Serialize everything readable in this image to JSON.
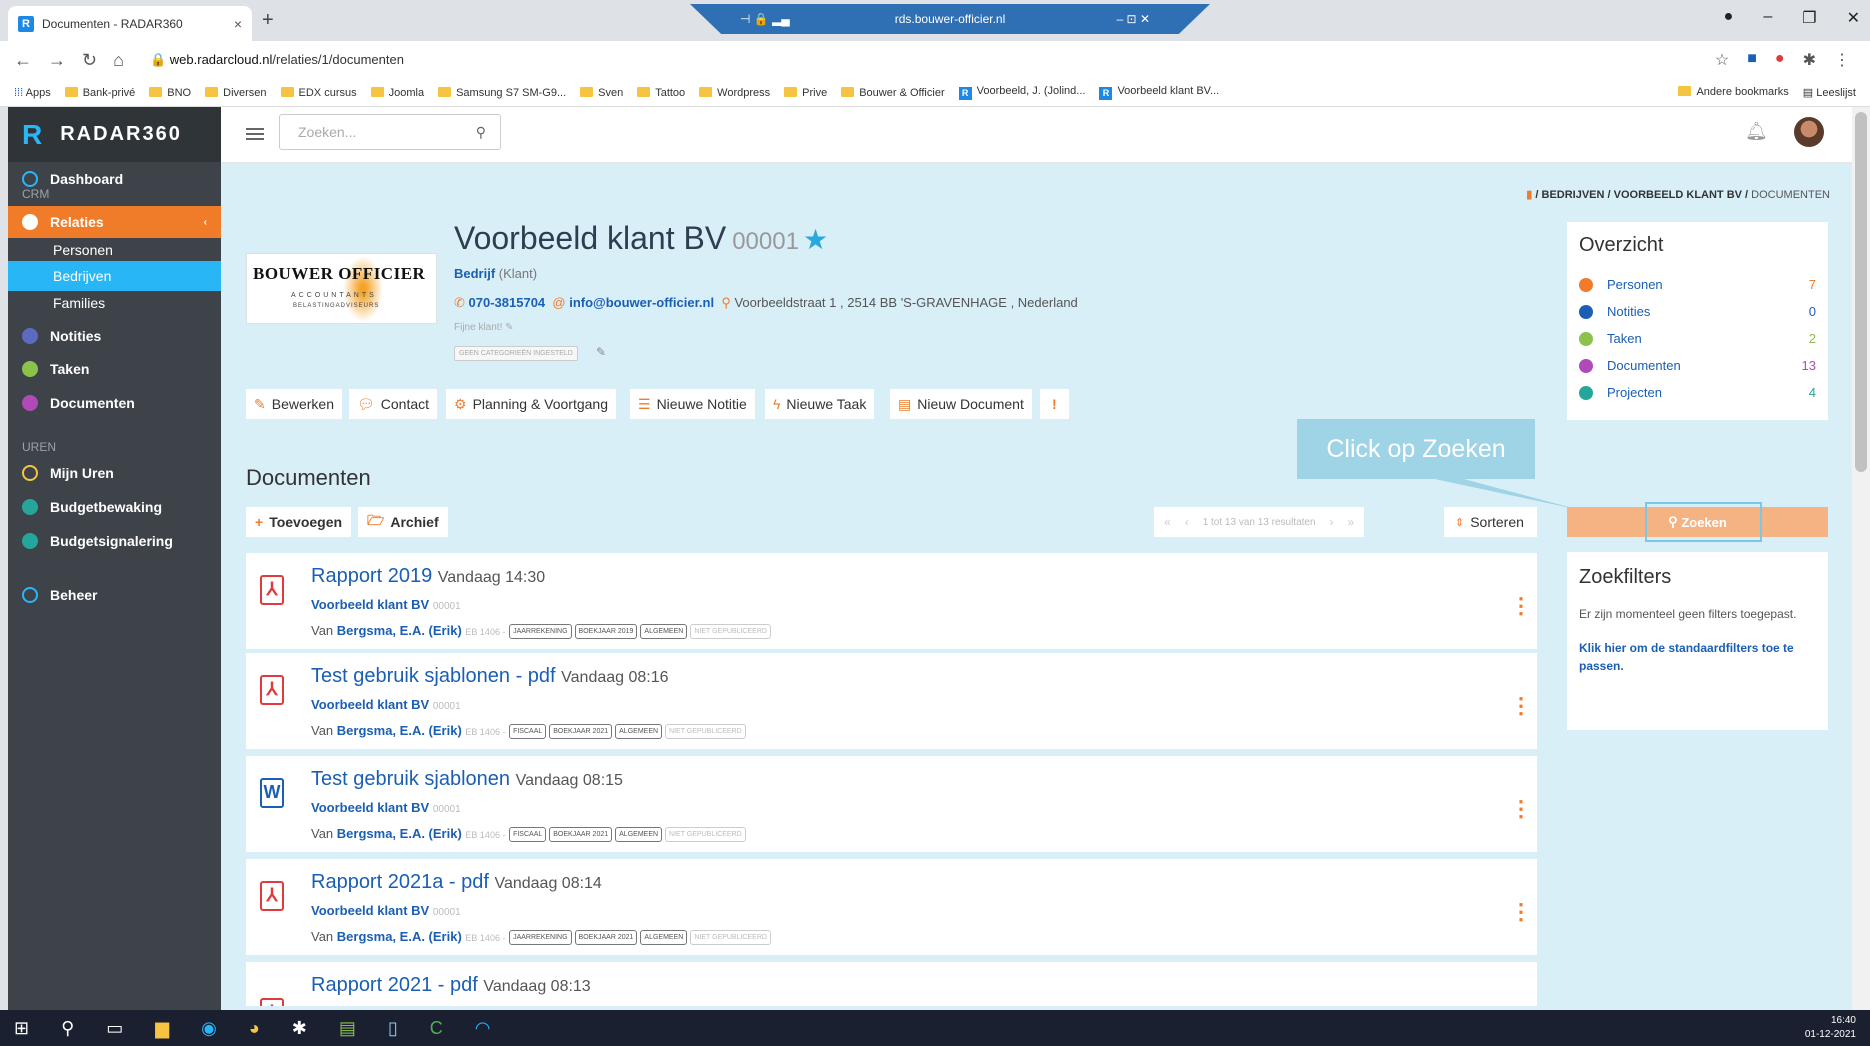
{
  "browser": {
    "tab_title": "Documenten - RADAR360",
    "tab_favicon": "R",
    "remote_title": "rds.bouwer-officier.nl",
    "url_domain": "web.radarcloud.nl",
    "url_path": "/relaties/1/documenten",
    "bookmarks": [
      "Apps",
      "Bank-privé",
      "BNO",
      "Diversen",
      "EDX cursus",
      "Joomla",
      "Samsung S7 SM-G9...",
      "Sven",
      "Tattoo",
      "Wordpress",
      "Prive",
      "Bouwer & Officier",
      "Voorbeeld, J. (Jolind...",
      "Voorbeeld klant BV..."
    ],
    "bookmarks_right": [
      "Andere bookmarks",
      "Leeslijst"
    ]
  },
  "sidebar": {
    "logo_mark": "R",
    "logo_text": "RADAR360",
    "dashboard": "Dashboard",
    "section_crm": "CRM",
    "relaties": "Relaties",
    "personen": "Personen",
    "bedrijven": "Bedrijven",
    "families": "Families",
    "notities": "Notities",
    "taken": "Taken",
    "documenten": "Documenten",
    "section_uren": "UREN",
    "mijn_uren": "Mijn Uren",
    "budgetbewaking": "Budgetbewaking",
    "budgetsignalering": "Budgetsignalering",
    "beheer": "Beheer"
  },
  "topbar": {
    "search_placeholder": "Zoeken..."
  },
  "breadcrumb": {
    "bedrijven": "BEDRIJVEN",
    "klant": "VOORBEELD KLANT BV",
    "current": "DOCUMENTEN"
  },
  "company": {
    "logo_line1": "BOUWER OFFICIER",
    "logo_line2": "ACCOUNTANTS",
    "logo_line3": "BELASTINGADVISEURS",
    "name": "Voorbeeld klant BV",
    "number": "00001",
    "type": "Bedrijf",
    "subtype": "(Klant)",
    "phone": "070-3815704",
    "email": "info@bouwer-officier.nl",
    "address": "Voorbeeldstraat 1 , 2514 BB 'S-GRAVENHAGE , Nederland",
    "note": "Fijne klant!",
    "categories": "GEEN CATEGORIEËN INGESTELD"
  },
  "actions": {
    "bewerken": "Bewerken",
    "contact": "Contact",
    "planning": "Planning & Voortgang",
    "notitie": "Nieuwe Notitie",
    "taak": "Nieuwe Taak",
    "document": "Nieuw Document",
    "more": "!"
  },
  "documents_section": {
    "title": "Documenten",
    "toevoegen": "Toevoegen",
    "archief": "Archief",
    "pager_text": "1 tot 13 van 13 resultaten",
    "sorteren": "Sorteren"
  },
  "documents": [
    {
      "title": "Rapport 2019",
      "time": "Vandaag 14:30",
      "company": "Voorbeeld klant BV",
      "company_no": "00001",
      "by_prefix": "Van",
      "author": "Bergsma, E.A. (Erik)",
      "code": "EB 1406 -",
      "tags": [
        "JAARREKENING",
        "BOEKJAAR 2019",
        "ALGEMEEN"
      ],
      "status": "NIET GEPUBLICEERD",
      "icon": "pdf-icon"
    },
    {
      "title": "Test gebruik sjablonen - pdf",
      "time": "Vandaag 08:16",
      "company": "Voorbeeld klant BV",
      "company_no": "00001",
      "by_prefix": "Van",
      "author": "Bergsma, E.A. (Erik)",
      "code": "EB 1406 -",
      "tags": [
        "FISCAAL",
        "BOEKJAAR 2021",
        "ALGEMEEN"
      ],
      "status": "NIET GEPUBLICEERD",
      "icon": "pdf-icon"
    },
    {
      "title": "Test gebruik sjablonen",
      "time": "Vandaag 08:15",
      "company": "Voorbeeld klant BV",
      "company_no": "00001",
      "by_prefix": "Van",
      "author": "Bergsma, E.A. (Erik)",
      "code": "EB 1406 -",
      "tags": [
        "FISCAAL",
        "BOEKJAAR 2021",
        "ALGEMEEN"
      ],
      "status": "NIET GEPUBLICEERD",
      "icon": "word-icon"
    },
    {
      "title": "Rapport 2021a - pdf",
      "time": "Vandaag 08:14",
      "company": "Voorbeeld klant BV",
      "company_no": "00001",
      "by_prefix": "Van",
      "author": "Bergsma, E.A. (Erik)",
      "code": "EB 1406 -",
      "tags": [
        "JAARREKENING",
        "BOEKJAAR 2021",
        "ALGEMEEN"
      ],
      "status": "NIET GEPUBLICEERD",
      "icon": "pdf-icon"
    },
    {
      "title": "Rapport 2021 - pdf",
      "time": "Vandaag 08:13",
      "icon": "pdf-icon"
    }
  ],
  "overzicht": {
    "title": "Overzicht",
    "rows": [
      {
        "label": "Personen",
        "value": "7",
        "color": "#f07c2a"
      },
      {
        "label": "Notities",
        "value": "0",
        "color": "#1a5fb4"
      },
      {
        "label": "Taken",
        "value": "2",
        "color": "#8bc34a"
      },
      {
        "label": "Documenten",
        "value": "13",
        "color": "#b04ab8"
      },
      {
        "label": "Projecten",
        "value": "4",
        "color": "#26a69a"
      }
    ]
  },
  "callout": "Click op Zoeken",
  "zoek_button": "Zoeken",
  "zoekfilters": {
    "title": "Zoekfilters",
    "text": "Er zijn momenteel geen filters toegepast.",
    "link": "Klik hier om de standaardfilters toe te passen."
  },
  "taskbar": {
    "time": "16:40",
    "date": "01-12-2021"
  },
  "colors": {
    "accent": "#f07c2a",
    "link": "#1a5fb4",
    "sidebar": "#3d4348",
    "active_sub": "#29b6f6"
  }
}
